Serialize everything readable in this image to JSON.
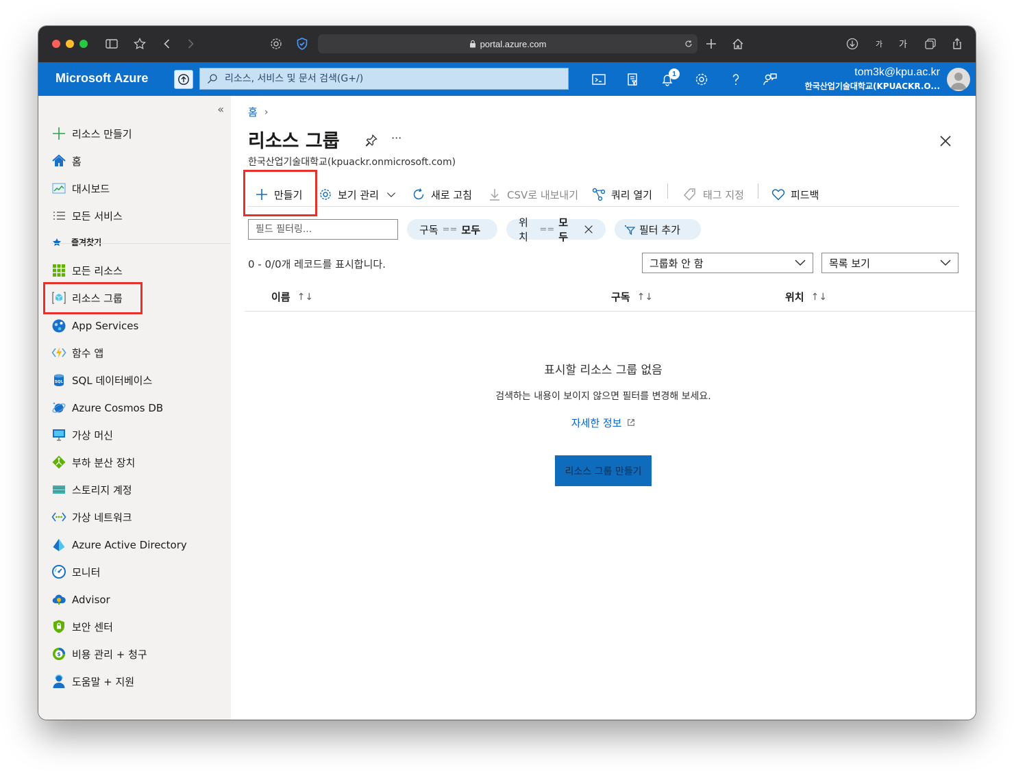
{
  "browser": {
    "url": "portal.azure.com",
    "text_size_small": "가",
    "text_size_large": "가"
  },
  "header": {
    "brand": "Microsoft Azure",
    "search_placeholder": "리소스, 서비스 및 문서 검색(G+/)",
    "notification_count": "1",
    "account_email": "tom3k@kpu.ac.kr",
    "account_tenant": "한국산업기술대학교(KPUACKR.O..."
  },
  "sidebar": {
    "collapse": "«",
    "create_resource": "리소스 만들기",
    "home": "홈",
    "dashboard": "대시보드",
    "all_services": "모든 서비스",
    "favorites": "즐겨찾기",
    "items": [
      {
        "label": "모든 리소스"
      },
      {
        "label": "리소스 그룹"
      },
      {
        "label": "App Services"
      },
      {
        "label": "함수 앱"
      },
      {
        "label": "SQL 데이터베이스"
      },
      {
        "label": "Azure Cosmos DB"
      },
      {
        "label": "가상 머신"
      },
      {
        "label": "부하 분산 장치"
      },
      {
        "label": "스토리지 계정"
      },
      {
        "label": "가상 네트워크"
      },
      {
        "label": "Azure Active Directory"
      },
      {
        "label": "모니터"
      },
      {
        "label": "Advisor"
      },
      {
        "label": "보안 센터"
      },
      {
        "label": "비용 관리 + 청구"
      },
      {
        "label": "도움말 + 지원"
      }
    ]
  },
  "main": {
    "breadcrumb_home": "홈",
    "title": "리소스 그룹",
    "more": "···",
    "subtitle": "한국산업기술대학교(kpuackr.onmicrosoft.com)",
    "commands": {
      "create": "만들기",
      "manage_view": "보기 관리",
      "refresh": "새로 고침",
      "export_csv": "CSV로 내보내기",
      "open_query": "쿼리 열기",
      "assign_tags": "태그 지정",
      "feedback": "피드백"
    },
    "filter_placeholder": "필드 필터링...",
    "pills": {
      "subscription_key": "구독",
      "subscription_op": "==",
      "subscription_val": "모두",
      "location_key": "위치",
      "location_op": "==",
      "location_val": "모두",
      "add_filter": "필터 추가"
    },
    "record_count": "0 - 0/0개 레코드를 표시합니다.",
    "grouping": "그룹화 안 함",
    "view_mode": "목록 보기",
    "columns": {
      "name": "이름",
      "subscription": "구독",
      "location": "위치",
      "sort_glyph": "↑↓"
    },
    "empty": {
      "title": "표시할 리소스 그룹 없음",
      "desc": "검색하는 내용이 보이지 않으면 필터를 변경해 보세요.",
      "learn_more": "자세한 정보",
      "create_button": "리소스 그룹 만들기"
    }
  },
  "colors": {
    "azure_blue": "#0b6fcb",
    "highlight_red": "#e5312a",
    "link": "#0066c8"
  }
}
